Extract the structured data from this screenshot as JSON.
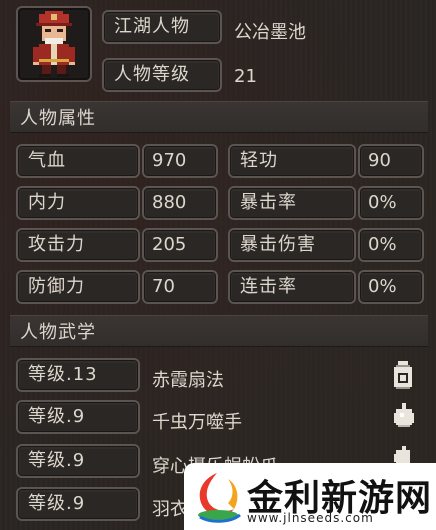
{
  "character": {
    "name_label": "江湖人物",
    "name_value": "公冶墨池",
    "level_label": "人物等级",
    "level_value": "21"
  },
  "attributes": {
    "section_title": "人物属性",
    "items": [
      {
        "label": "气血",
        "value": "970"
      },
      {
        "label": "轻功",
        "value": "90"
      },
      {
        "label": "内力",
        "value": "880"
      },
      {
        "label": "暴击率",
        "value": "0%"
      },
      {
        "label": "攻击力",
        "value": "205"
      },
      {
        "label": "暴击伤害",
        "value": "0%"
      },
      {
        "label": "防御力",
        "value": "70"
      },
      {
        "label": "连击率",
        "value": "0%"
      }
    ]
  },
  "martial_arts": {
    "section_title": "人物武学",
    "items": [
      {
        "level": "等级.13",
        "name": "赤霞扇法",
        "icon": "potion-icon"
      },
      {
        "level": "等级.9",
        "name": "千虫万噬手",
        "icon": "palm-icon"
      },
      {
        "level": "等级.9",
        "name": "穿心摄乐蜈蚣爪",
        "icon": "claw-icon"
      },
      {
        "level": "等级.9",
        "name": "羽衣",
        "icon": "unknown"
      }
    ]
  },
  "watermark": {
    "title": "金利新游网",
    "url": "www.jlnseeds.com"
  },
  "colors": {
    "frame": "#5b5450",
    "panel": "#2b2725",
    "text": "#ddd6cc",
    "portrait_red": "#9c2a23"
  }
}
